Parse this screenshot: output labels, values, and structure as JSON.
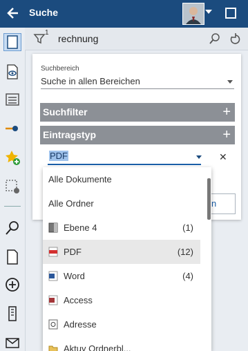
{
  "header": {
    "title": "Suche"
  },
  "search": {
    "filter_count": "1",
    "query": "rechnung"
  },
  "panel": {
    "area_label": "Suchbereich",
    "area_value": "Suche in allen Bereichen",
    "filter_bar": "Suchfilter",
    "type_bar": "Eintragstyp",
    "type_value": "PDF",
    "button_label": "n"
  },
  "dropdown": {
    "items": [
      {
        "label": "Alle Dokumente",
        "count": "",
        "icon": "none"
      },
      {
        "label": "Alle Ordner",
        "count": "",
        "icon": "none"
      },
      {
        "label": "Ebene 4",
        "count": "(1)",
        "icon": "folder-level-icon"
      },
      {
        "label": "PDF",
        "count": "(12)",
        "icon": "pdf-icon"
      },
      {
        "label": "Word",
        "count": "(4)",
        "icon": "word-icon"
      },
      {
        "label": "Access",
        "count": "",
        "icon": "access-icon"
      },
      {
        "label": "Adresse",
        "count": "",
        "icon": "address-icon"
      },
      {
        "label": "Aktuy Ordnerbl...",
        "count": "",
        "icon": "folder-icon"
      }
    ],
    "selected_index": 3
  },
  "colors": {
    "header": "#1b4b7e",
    "accent": "#1b5fa8",
    "bar": "#8c9096"
  }
}
